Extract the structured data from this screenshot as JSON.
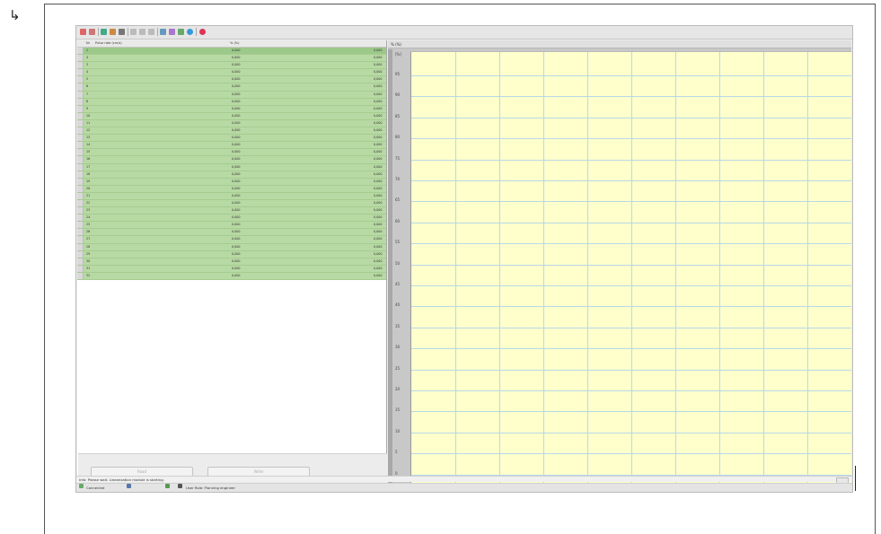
{
  "grid": {
    "col_nr": "Nr",
    "col_pulse": "Pulse rate (cm/s)",
    "col_pct": "% (%)",
    "rows": [
      {
        "no": "1",
        "v1": "0,000",
        "v2": "0,000"
      },
      {
        "no": "4",
        "v1": "0,000",
        "v2": "0,000"
      },
      {
        "no": "3",
        "v1": "0,000",
        "v2": "0,000"
      },
      {
        "no": "4",
        "v1": "0,000",
        "v2": "0,000"
      },
      {
        "no": "5",
        "v1": "0,000",
        "v2": "0,000"
      },
      {
        "no": "6",
        "v1": "0,000",
        "v2": "0,000"
      },
      {
        "no": "7",
        "v1": "0,000",
        "v2": "0,000"
      },
      {
        "no": "8",
        "v1": "0,000",
        "v2": "0,000"
      },
      {
        "no": "9",
        "v1": "0,000",
        "v2": "0,000"
      },
      {
        "no": "10",
        "v1": "0,000",
        "v2": "0,000"
      },
      {
        "no": "11",
        "v1": "0,000",
        "v2": "0,000"
      },
      {
        "no": "12",
        "v1": "0,000",
        "v2": "0,000"
      },
      {
        "no": "13",
        "v1": "0,000",
        "v2": "0,000"
      },
      {
        "no": "14",
        "v1": "0,000",
        "v2": "0,000"
      },
      {
        "no": "15",
        "v1": "0,000",
        "v2": "0,000"
      },
      {
        "no": "16",
        "v1": "0,000",
        "v2": "0,000"
      },
      {
        "no": "17",
        "v1": "0,000",
        "v2": "0,000"
      },
      {
        "no": "18",
        "v1": "0,000",
        "v2": "0,000"
      },
      {
        "no": "19",
        "v1": "0,000",
        "v2": "0,000"
      },
      {
        "no": "20",
        "v1": "0,000",
        "v2": "0,000"
      },
      {
        "no": "21",
        "v1": "0,000",
        "v2": "0,000"
      },
      {
        "no": "22",
        "v1": "0,000",
        "v2": "0,000"
      },
      {
        "no": "23",
        "v1": "0,000",
        "v2": "0,000"
      },
      {
        "no": "24",
        "v1": "0,000",
        "v2": "0,000"
      },
      {
        "no": "25",
        "v1": "0,000",
        "v2": "0,000"
      },
      {
        "no": "26",
        "v1": "0,000",
        "v2": "0,000"
      },
      {
        "no": "27",
        "v1": "0,000",
        "v2": "0,000"
      },
      {
        "no": "28",
        "v1": "0,000",
        "v2": "0,000"
      },
      {
        "no": "29",
        "v1": "0,000",
        "v2": "0,000"
      },
      {
        "no": "30",
        "v1": "0,000",
        "v2": "0,000"
      },
      {
        "no": "31",
        "v1": "0,000",
        "v2": "0,000"
      },
      {
        "no": "32",
        "v1": "0,000",
        "v2": "0,000"
      }
    ]
  },
  "buttons": {
    "read": "Read",
    "write": "Write"
  },
  "chart": {
    "header": "% (%)",
    "unit_label": "[%]",
    "y_ticks": [
      "95",
      "90",
      "85",
      "80",
      "75",
      "70",
      "65",
      "60",
      "55",
      "50",
      "45",
      "40",
      "35",
      "30",
      "25",
      "20",
      "15",
      "10",
      "5",
      "0"
    ]
  },
  "info_text": "Info: Please wait. Linearization module is starting.",
  "status": {
    "connected": "Connected",
    "user_role": "User Role: Planning engineer"
  },
  "colors": {
    "row_green": "#b7d9a3",
    "plot_bg": "#ffffcc",
    "grid_line": "#b8d8e8"
  },
  "icons": [
    "open-icon",
    "save-icon",
    "table-icon",
    "chart-icon",
    "pen-icon",
    "copy-icon",
    "paste-icon",
    "delete-icon",
    "import-icon",
    "export-icon",
    "refresh-icon",
    "info-icon",
    "help-icon"
  ]
}
